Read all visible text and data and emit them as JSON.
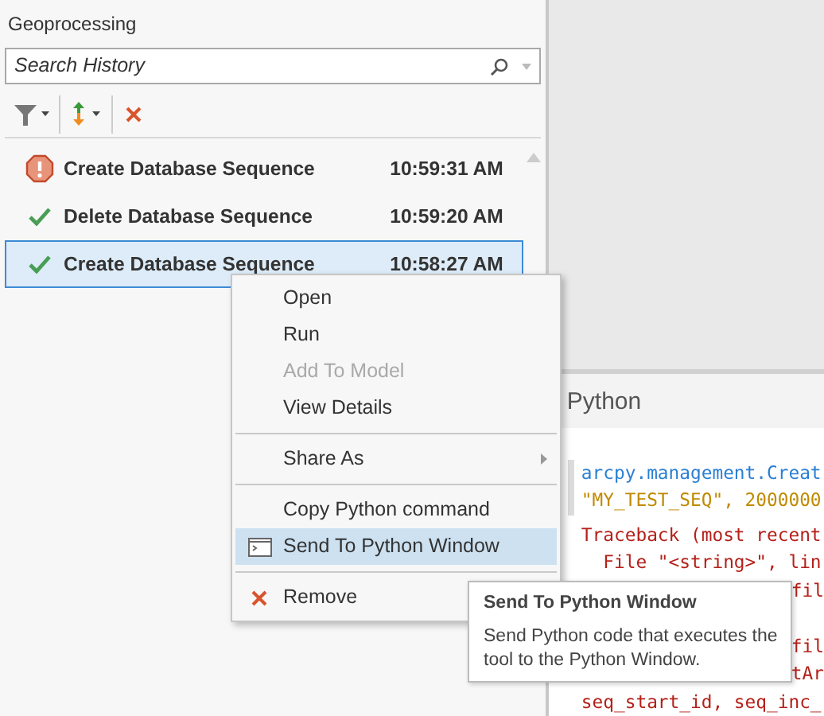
{
  "panel": {
    "title": "Geoprocessing"
  },
  "search": {
    "placeholder": "Search History"
  },
  "history": [
    {
      "kind": "error",
      "name": "Create Database Sequence",
      "time": "10:59:31 AM",
      "selected": false
    },
    {
      "kind": "success",
      "name": "Delete Database Sequence",
      "time": "10:59:20 AM",
      "selected": false
    },
    {
      "kind": "success",
      "name": "Create Database Sequence",
      "time": "10:58:27 AM",
      "selected": true
    }
  ],
  "context_menu": [
    {
      "kind": "item",
      "label": "Open",
      "disabled": false,
      "selected": false
    },
    {
      "kind": "item",
      "label": "Run",
      "disabled": false,
      "selected": false
    },
    {
      "kind": "item",
      "label": "Add To Model",
      "disabled": true,
      "selected": false
    },
    {
      "kind": "item",
      "label": "View Details",
      "disabled": false,
      "selected": false
    },
    {
      "kind": "separator"
    },
    {
      "kind": "submenu",
      "label": "Share As",
      "disabled": false,
      "selected": false
    },
    {
      "kind": "separator"
    },
    {
      "kind": "item",
      "label": "Copy Python command",
      "disabled": false,
      "selected": false
    },
    {
      "kind": "window",
      "label": "Send To Python Window",
      "disabled": false,
      "selected": true
    },
    {
      "kind": "separator"
    },
    {
      "kind": "remove",
      "label": "Remove",
      "disabled": false,
      "selected": false
    }
  ],
  "tooltip": {
    "title": "Send To Python Window",
    "text": "Send Python code that executes the tool to the Python Window."
  },
  "python": {
    "title": "Python",
    "lines": [
      {
        "kind": "command",
        "text": "arcpy.management.Creat"
      },
      {
        "kind": "argument",
        "text": "\"MY_TEST_SEQ\", 2000000"
      },
      {
        "kind": "error",
        "text": "Traceback (most recent"
      },
      {
        "kind": "error",
        "text": "  File \"<string>\", lin"
      },
      {
        "kind": "error-tail",
        "text": "fil"
      },
      {
        "kind": "blank"
      },
      {
        "kind": "error-tail",
        "text": "fil"
      },
      {
        "kind": "error-tail",
        "text": "tAr"
      },
      {
        "kind": "error",
        "text": "seq_start_id, seq_inc_"
      }
    ]
  }
}
